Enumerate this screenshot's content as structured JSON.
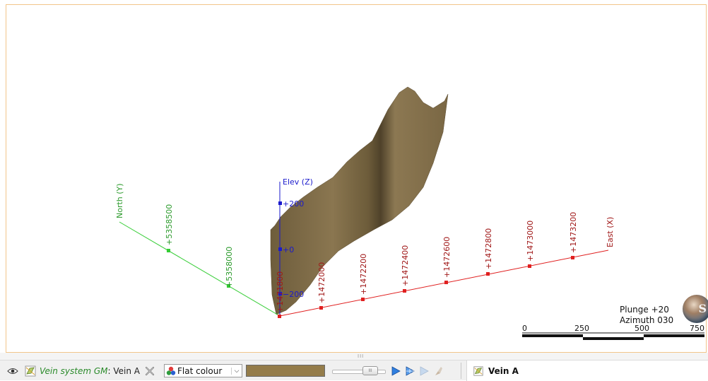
{
  "scene": {
    "axes": {
      "north": {
        "label": "North (Y)",
        "color": "#33cc33",
        "ticks": [
          "+5358500",
          "+5358000"
        ]
      },
      "east": {
        "label": "East (X)",
        "color": "#e02020",
        "ticks": [
          "+1472000",
          "+1472200",
          "+1472400",
          "+1472600",
          "+1472800",
          "+1473000",
          "+1473200"
        ],
        "origin_tick": "+1471800"
      },
      "elev": {
        "label": "Elev (Z)",
        "color": "#1a1acc",
        "ticks": [
          "+200",
          "+0",
          "−200"
        ]
      }
    },
    "surface_color": "#85704a"
  },
  "orientation": {
    "plunge": "Plunge +20",
    "azimuth": "Azimuth 030"
  },
  "compass_glyph": "S",
  "scale_bar": {
    "labels": [
      "0",
      "250",
      "500",
      "750"
    ]
  },
  "toolbar": {
    "visibility_icon": "eye-icon",
    "object_prefix": "Vein system GM",
    "object_suffix": ": Vein A",
    "colour_mode": "Flat colour",
    "colour_swatch": "#947c4a",
    "opacity_thumb": "III"
  },
  "splitter_grip": "III",
  "tab": {
    "label": "Vein A"
  }
}
